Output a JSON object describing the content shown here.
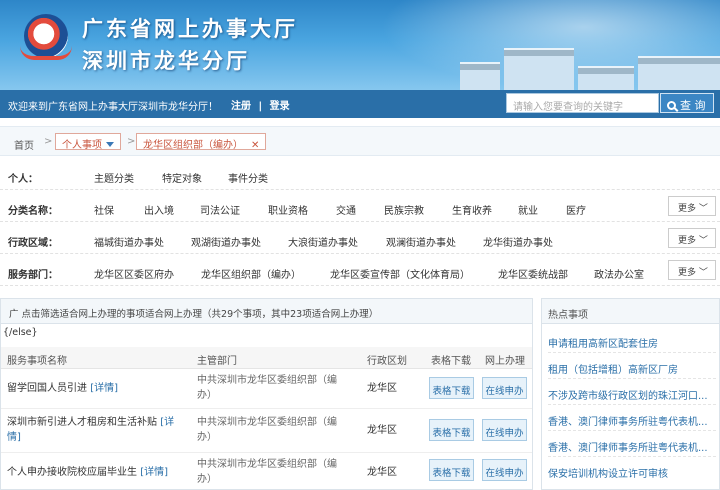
{
  "banner": {
    "title_line1": "广东省网上办事大厅",
    "title_line2": "深圳市龙华分厅"
  },
  "topbar": {
    "welcome": "欢迎来到广东省网上办事大厅深圳市龙华分厅！",
    "register": "注册",
    "divider": "|",
    "login": "登录",
    "search_placeholder": "请输入您要查询的关键字",
    "search_button": "查 询"
  },
  "breadcrumb": {
    "home": "首页",
    "sep": ">",
    "level1": "个人事项",
    "level2": "龙华区组织部（编办）",
    "close": "✕"
  },
  "filters": {
    "personal": {
      "label": "个人：",
      "items": [
        "主题分类",
        "特定对象",
        "事件分类"
      ]
    },
    "category": {
      "label": "分类名称：",
      "items": [
        "社保",
        "出入境",
        "司法公证",
        "职业资格",
        "交通",
        "民族宗教",
        "生育收养",
        "就业",
        "医疗"
      ],
      "more": "更多"
    },
    "region": {
      "label": "行政区域：",
      "items": [
        "福城街道办事处",
        "观湖街道办事处",
        "大浪街道办事处",
        "观澜街道办事处",
        "龙华街道办事处"
      ],
      "more": "更多"
    },
    "dept": {
      "label": "服务部门：",
      "items": [
        "龙华区区委区府办",
        "龙华区组织部（编办）",
        "龙华区委宣传部（文化体育局）",
        "龙华区委统战部",
        "政法办公室"
      ],
      "more": "更多"
    }
  },
  "list": {
    "summary": "广 点击筛选适合网上办理的事项适合网上办理（共29个事项，其中23项适合网上办理）",
    "else_tag": "{/else}",
    "columns": [
      "服务事项名称",
      "主管部门",
      "行政区划",
      "表格下载",
      "网上办理"
    ],
    "detail_label": "[详情]",
    "rows": [
      {
        "name": "留学回国人员引进",
        "dept_line1": "中共深圳市龙华区委组织部（编",
        "dept_line2": "办）",
        "region": "龙华区",
        "download": "表格下载",
        "apply": "在线申办"
      },
      {
        "name": "深圳市新引进人才租房和生活补贴",
        "dept_line1": "中共深圳市龙华区委组织部（编",
        "dept_line2": "办）",
        "region": "龙华区",
        "download": "表格下载",
        "apply": "在线申办"
      },
      {
        "name": "个人申办接收院校应届毕业生",
        "dept_line1": "中共深圳市龙华区委组织部（编",
        "dept_line2": "办）",
        "region": "龙华区",
        "download": "表格下载",
        "apply": "在线申办"
      }
    ]
  },
  "hot": {
    "title": "热点事项",
    "items": [
      "申请租用高新区配套住房",
      "租用（包括增租）高新区厂房",
      "不涉及跨市级行政区划的珠江河口...",
      "香港、澳门律师事务所驻粤代表机...",
      "香港、澳门律师事务所驻粤代表机...",
      "保安培训机构设立许可审核"
    ]
  },
  "colors": {
    "banner": "#2e86c8",
    "navbar": "#2a6fa8",
    "link": "#2a6fa8",
    "tag": "#c9553d"
  }
}
